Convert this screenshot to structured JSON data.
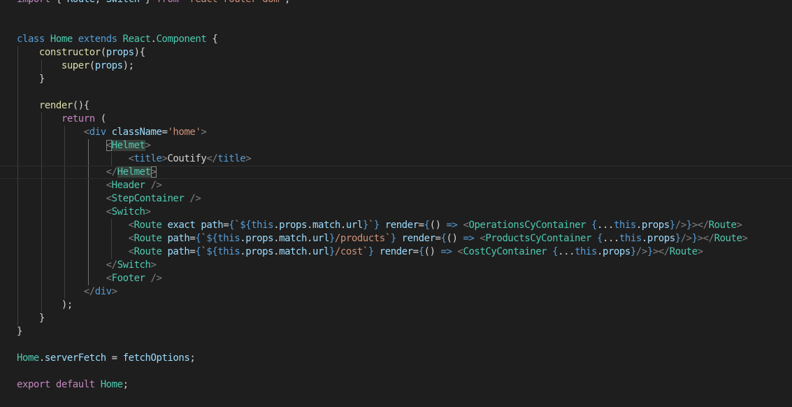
{
  "editor": {
    "theme": "dark",
    "background": "#1e1e1e",
    "lines": [
      {
        "indent": 0,
        "tokens": [
          {
            "c": "keyword",
            "t": "import"
          },
          {
            "c": "punct",
            "t": " { "
          },
          {
            "c": "variable",
            "t": "Route"
          },
          {
            "c": "punct",
            "t": ", "
          },
          {
            "c": "variable",
            "t": "Switch"
          },
          {
            "c": "punct",
            "t": " } "
          },
          {
            "c": "keyword",
            "t": "from"
          },
          {
            "c": "punct",
            "t": " "
          },
          {
            "c": "string",
            "t": "\"react-router-dom\""
          },
          {
            "c": "punct",
            "t": ";"
          }
        ]
      },
      {
        "indent": 0,
        "tokens": []
      },
      {
        "indent": 0,
        "tokens": []
      },
      {
        "indent": 0,
        "tokens": [
          {
            "c": "storage",
            "t": "class"
          },
          {
            "c": "punct",
            "t": " "
          },
          {
            "c": "class",
            "t": "Home"
          },
          {
            "c": "punct",
            "t": " "
          },
          {
            "c": "storage",
            "t": "extends"
          },
          {
            "c": "punct",
            "t": " "
          },
          {
            "c": "class",
            "t": "React"
          },
          {
            "c": "punct",
            "t": "."
          },
          {
            "c": "class",
            "t": "Component"
          },
          {
            "c": "punct",
            "t": " {"
          }
        ]
      },
      {
        "indent": 1,
        "tokens": [
          {
            "c": "function",
            "t": "constructor"
          },
          {
            "c": "punct",
            "t": "("
          },
          {
            "c": "variable",
            "t": "props"
          },
          {
            "c": "punct",
            "t": "){"
          }
        ]
      },
      {
        "indent": 2,
        "tokens": [
          {
            "c": "function",
            "t": "super"
          },
          {
            "c": "punct",
            "t": "("
          },
          {
            "c": "variable",
            "t": "props"
          },
          {
            "c": "punct",
            "t": ");"
          }
        ]
      },
      {
        "indent": 1,
        "tokens": [
          {
            "c": "punct",
            "t": "}"
          }
        ]
      },
      {
        "indent": 0,
        "tokens": []
      },
      {
        "indent": 1,
        "tokens": [
          {
            "c": "function",
            "t": "render"
          },
          {
            "c": "punct",
            "t": "(){"
          }
        ]
      },
      {
        "indent": 2,
        "tokens": [
          {
            "c": "keyword",
            "t": "return"
          },
          {
            "c": "punct",
            "t": " ("
          }
        ]
      },
      {
        "indent": 3,
        "tokens": [
          {
            "c": "tagbracket",
            "t": "<"
          },
          {
            "c": "tag",
            "t": "div"
          },
          {
            "c": "punct",
            "t": " "
          },
          {
            "c": "attr",
            "t": "className"
          },
          {
            "c": "punct",
            "t": "="
          },
          {
            "c": "string",
            "t": "'home'"
          },
          {
            "c": "tagbracket",
            "t": ">"
          }
        ]
      },
      {
        "indent": 4,
        "tokens": [
          {
            "c": "tagbracket",
            "t": "<",
            "hl": "bracket"
          },
          {
            "c": "component",
            "t": "Helmet",
            "hl": "word"
          },
          {
            "c": "tagbracket",
            "t": ">"
          }
        ]
      },
      {
        "indent": 5,
        "tokens": [
          {
            "c": "tagbracket",
            "t": "<"
          },
          {
            "c": "tag",
            "t": "title"
          },
          {
            "c": "tagbracket",
            "t": ">"
          },
          {
            "c": "text",
            "t": "Coutify"
          },
          {
            "c": "tagbracket",
            "t": "</"
          },
          {
            "c": "tag",
            "t": "title"
          },
          {
            "c": "tagbracket",
            "t": ">"
          }
        ]
      },
      {
        "indent": 4,
        "current": true,
        "tokens": [
          {
            "c": "tagbracket",
            "t": "</"
          },
          {
            "c": "component",
            "t": "Helmet",
            "hl": "word"
          },
          {
            "c": "tagbracket",
            "t": ">",
            "hl": "bracket"
          }
        ]
      },
      {
        "indent": 4,
        "tokens": [
          {
            "c": "tagbracket",
            "t": "<"
          },
          {
            "c": "component",
            "t": "Header"
          },
          {
            "c": "punct",
            "t": " "
          },
          {
            "c": "tagbracket",
            "t": "/>"
          }
        ]
      },
      {
        "indent": 4,
        "tokens": [
          {
            "c": "tagbracket",
            "t": "<"
          },
          {
            "c": "component",
            "t": "StepContainer"
          },
          {
            "c": "punct",
            "t": " "
          },
          {
            "c": "tagbracket",
            "t": "/>"
          }
        ]
      },
      {
        "indent": 4,
        "tokens": [
          {
            "c": "tagbracket",
            "t": "<"
          },
          {
            "c": "component",
            "t": "Switch"
          },
          {
            "c": "tagbracket",
            "t": ">"
          }
        ]
      },
      {
        "indent": 5,
        "tokens": [
          {
            "c": "tagbracket",
            "t": "<"
          },
          {
            "c": "component",
            "t": "Route"
          },
          {
            "c": "punct",
            "t": " "
          },
          {
            "c": "attr",
            "t": "exact"
          },
          {
            "c": "punct",
            "t": " "
          },
          {
            "c": "attr",
            "t": "path"
          },
          {
            "c": "punct",
            "t": "="
          },
          {
            "c": "brace",
            "t": "{"
          },
          {
            "c": "string",
            "t": "`"
          },
          {
            "c": "brace",
            "t": "${"
          },
          {
            "c": "storage",
            "t": "this"
          },
          {
            "c": "punct",
            "t": "."
          },
          {
            "c": "variable",
            "t": "props"
          },
          {
            "c": "punct",
            "t": "."
          },
          {
            "c": "variable",
            "t": "match"
          },
          {
            "c": "punct",
            "t": "."
          },
          {
            "c": "variable",
            "t": "url"
          },
          {
            "c": "brace",
            "t": "}"
          },
          {
            "c": "string",
            "t": "`"
          },
          {
            "c": "brace",
            "t": "}"
          },
          {
            "c": "punct",
            "t": " "
          },
          {
            "c": "attr",
            "t": "render"
          },
          {
            "c": "punct",
            "t": "="
          },
          {
            "c": "brace",
            "t": "{"
          },
          {
            "c": "punct",
            "t": "() "
          },
          {
            "c": "storage",
            "t": "=>"
          },
          {
            "c": "punct",
            "t": " "
          },
          {
            "c": "tagbracket",
            "t": "<"
          },
          {
            "c": "component",
            "t": "OperationsCyContainer"
          },
          {
            "c": "punct",
            "t": " "
          },
          {
            "c": "brace",
            "t": "{"
          },
          {
            "c": "punct",
            "t": "..."
          },
          {
            "c": "storage",
            "t": "this"
          },
          {
            "c": "punct",
            "t": "."
          },
          {
            "c": "variable",
            "t": "props"
          },
          {
            "c": "brace",
            "t": "}"
          },
          {
            "c": "tagbracket",
            "t": "/>"
          },
          {
            "c": "brace",
            "t": "}"
          },
          {
            "c": "tagbracket",
            "t": "></"
          },
          {
            "c": "component",
            "t": "Route"
          },
          {
            "c": "tagbracket",
            "t": ">"
          }
        ]
      },
      {
        "indent": 5,
        "tokens": [
          {
            "c": "tagbracket",
            "t": "<"
          },
          {
            "c": "component",
            "t": "Route"
          },
          {
            "c": "punct",
            "t": " "
          },
          {
            "c": "attr",
            "t": "path"
          },
          {
            "c": "punct",
            "t": "="
          },
          {
            "c": "brace",
            "t": "{"
          },
          {
            "c": "string",
            "t": "`"
          },
          {
            "c": "brace",
            "t": "${"
          },
          {
            "c": "storage",
            "t": "this"
          },
          {
            "c": "punct",
            "t": "."
          },
          {
            "c": "variable",
            "t": "props"
          },
          {
            "c": "punct",
            "t": "."
          },
          {
            "c": "variable",
            "t": "match"
          },
          {
            "c": "punct",
            "t": "."
          },
          {
            "c": "variable",
            "t": "url"
          },
          {
            "c": "brace",
            "t": "}"
          },
          {
            "c": "string",
            "t": "/products`"
          },
          {
            "c": "brace",
            "t": "}"
          },
          {
            "c": "punct",
            "t": " "
          },
          {
            "c": "attr",
            "t": "render"
          },
          {
            "c": "punct",
            "t": "="
          },
          {
            "c": "brace",
            "t": "{"
          },
          {
            "c": "punct",
            "t": "() "
          },
          {
            "c": "storage",
            "t": "=>"
          },
          {
            "c": "punct",
            "t": " "
          },
          {
            "c": "tagbracket",
            "t": "<"
          },
          {
            "c": "component",
            "t": "ProductsCyContainer"
          },
          {
            "c": "punct",
            "t": " "
          },
          {
            "c": "brace",
            "t": "{"
          },
          {
            "c": "punct",
            "t": "..."
          },
          {
            "c": "storage",
            "t": "this"
          },
          {
            "c": "punct",
            "t": "."
          },
          {
            "c": "variable",
            "t": "props"
          },
          {
            "c": "brace",
            "t": "}"
          },
          {
            "c": "tagbracket",
            "t": "/>"
          },
          {
            "c": "brace",
            "t": "}"
          },
          {
            "c": "tagbracket",
            "t": "></"
          },
          {
            "c": "component",
            "t": "Route"
          },
          {
            "c": "tagbracket",
            "t": ">"
          }
        ]
      },
      {
        "indent": 5,
        "tokens": [
          {
            "c": "tagbracket",
            "t": "<"
          },
          {
            "c": "component",
            "t": "Route"
          },
          {
            "c": "punct",
            "t": " "
          },
          {
            "c": "attr",
            "t": "path"
          },
          {
            "c": "punct",
            "t": "="
          },
          {
            "c": "brace",
            "t": "{"
          },
          {
            "c": "string",
            "t": "`"
          },
          {
            "c": "brace",
            "t": "${"
          },
          {
            "c": "storage",
            "t": "this"
          },
          {
            "c": "punct",
            "t": "."
          },
          {
            "c": "variable",
            "t": "props"
          },
          {
            "c": "punct",
            "t": "."
          },
          {
            "c": "variable",
            "t": "match"
          },
          {
            "c": "punct",
            "t": "."
          },
          {
            "c": "variable",
            "t": "url"
          },
          {
            "c": "brace",
            "t": "}"
          },
          {
            "c": "string",
            "t": "/cost`"
          },
          {
            "c": "brace",
            "t": "}"
          },
          {
            "c": "punct",
            "t": " "
          },
          {
            "c": "attr",
            "t": "render"
          },
          {
            "c": "punct",
            "t": "="
          },
          {
            "c": "brace",
            "t": "{"
          },
          {
            "c": "punct",
            "t": "() "
          },
          {
            "c": "storage",
            "t": "=>"
          },
          {
            "c": "punct",
            "t": " "
          },
          {
            "c": "tagbracket",
            "t": "<"
          },
          {
            "c": "component",
            "t": "CostCyContainer"
          },
          {
            "c": "punct",
            "t": " "
          },
          {
            "c": "brace",
            "t": "{"
          },
          {
            "c": "punct",
            "t": "..."
          },
          {
            "c": "storage",
            "t": "this"
          },
          {
            "c": "punct",
            "t": "."
          },
          {
            "c": "variable",
            "t": "props"
          },
          {
            "c": "brace",
            "t": "}"
          },
          {
            "c": "tagbracket",
            "t": "/>"
          },
          {
            "c": "brace",
            "t": "}"
          },
          {
            "c": "tagbracket",
            "t": "></"
          },
          {
            "c": "component",
            "t": "Route"
          },
          {
            "c": "tagbracket",
            "t": ">"
          }
        ]
      },
      {
        "indent": 4,
        "tokens": [
          {
            "c": "tagbracket",
            "t": "</"
          },
          {
            "c": "component",
            "t": "Switch"
          },
          {
            "c": "tagbracket",
            "t": ">"
          }
        ]
      },
      {
        "indent": 4,
        "tokens": [
          {
            "c": "tagbracket",
            "t": "<"
          },
          {
            "c": "component",
            "t": "Footer"
          },
          {
            "c": "punct",
            "t": " "
          },
          {
            "c": "tagbracket",
            "t": "/>"
          }
        ]
      },
      {
        "indent": 3,
        "tokens": [
          {
            "c": "tagbracket",
            "t": "</"
          },
          {
            "c": "tag",
            "t": "div"
          },
          {
            "c": "tagbracket",
            "t": ">"
          }
        ]
      },
      {
        "indent": 2,
        "tokens": [
          {
            "c": "punct",
            "t": ");"
          }
        ]
      },
      {
        "indent": 1,
        "tokens": [
          {
            "c": "punct",
            "t": "}"
          }
        ]
      },
      {
        "indent": 0,
        "tokens": [
          {
            "c": "punct",
            "t": "}"
          }
        ]
      },
      {
        "indent": 0,
        "tokens": []
      },
      {
        "indent": 0,
        "tokens": [
          {
            "c": "class",
            "t": "Home"
          },
          {
            "c": "punct",
            "t": "."
          },
          {
            "c": "variable",
            "t": "serverFetch"
          },
          {
            "c": "punct",
            "t": " = "
          },
          {
            "c": "variable",
            "t": "fetchOptions"
          },
          {
            "c": "punct",
            "t": ";"
          }
        ]
      },
      {
        "indent": 0,
        "tokens": []
      },
      {
        "indent": 0,
        "tokens": [
          {
            "c": "keyword",
            "t": "export"
          },
          {
            "c": "punct",
            "t": " "
          },
          {
            "c": "keyword",
            "t": "default"
          },
          {
            "c": "punct",
            "t": " "
          },
          {
            "c": "class",
            "t": "Home"
          },
          {
            "c": "punct",
            "t": ";"
          }
        ]
      }
    ]
  }
}
